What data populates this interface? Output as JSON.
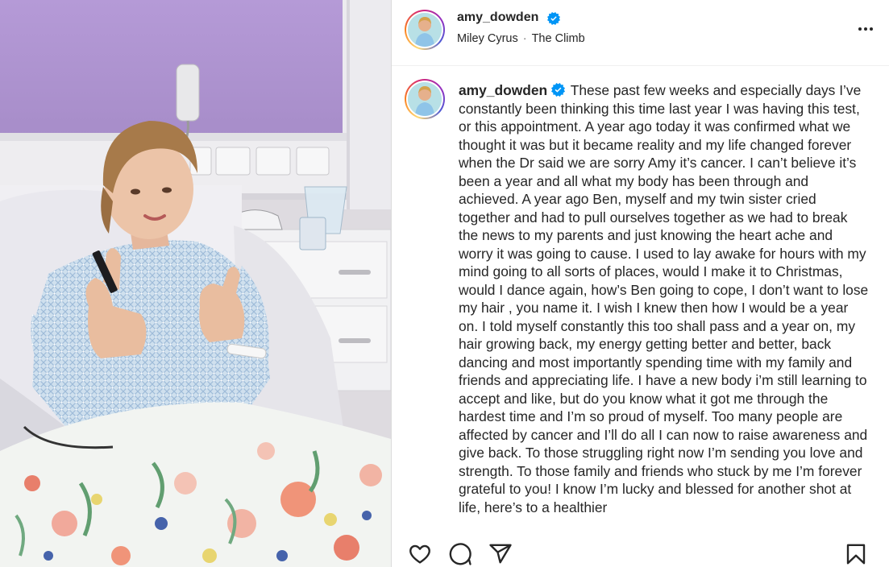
{
  "post": {
    "username": "amy_dowden",
    "audio": {
      "artist": "Miley Cyrus",
      "separator": "·",
      "track": "The Climb"
    },
    "caption": "These past few weeks and especially days I’ve constantly been thinking this time last year I was having this test, or this appointment. A year ago today it was confirmed what we thought it was but it became reality and my life changed forever when the Dr said we are sorry Amy it’s cancer. I can’t believe it’s been a year and all what my body has been through and achieved. A year ago Ben, myself and my twin sister cried together and had to pull ourselves together as we had to break the news to my parents and just knowing the heart ache and worry it was going to cause. I used to lay awake for hours with my mind going to all sorts of places, would I make it to Christmas, would I dance again, how’s Ben going to cope, I don’t want to lose my hair , you name it. I wish I knew then how I would be a year on. I told myself constantly this too shall pass and a year on, my hair growing back, my energy getting better and better, back dancing and most importantly spending time with my family and friends and appreciating life. I have a new body i’m still learning to accept and like, but do you know what it got me through the hardest time and I’m so proud of myself. Too many people are affected by cancer and I’ll do all I can now to raise awareness and give back. To those struggling right now I’m sending you love and strength. To those family and friends who stuck by me I’m forever grateful to you! I know I’m lucky and blessed for another shot at life, here’s to a healthier"
  },
  "icons": {
    "verified": "verified-badge-icon",
    "more": "more-options-icon",
    "like": "heart-icon",
    "comment": "comment-icon",
    "share": "send-icon",
    "save": "bookmark-icon"
  },
  "colors": {
    "verified": "#0095f6",
    "text": "#262626",
    "muted": "#737373",
    "wall": "#b89bd6"
  }
}
